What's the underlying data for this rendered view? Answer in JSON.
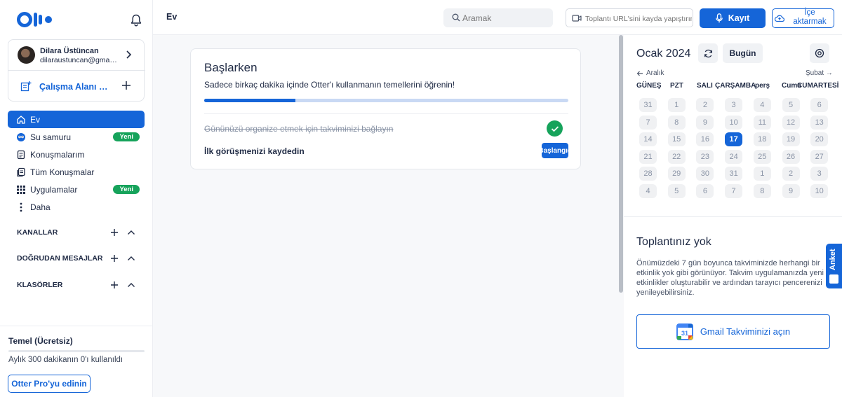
{
  "sidebar": {
    "account": {
      "name": "Dilara Üstüncan",
      "email": "dilaraustuncan@gmail.com"
    },
    "workspace_label": "Çalışma Alanı Oluştur",
    "nav": [
      {
        "label": "Ev",
        "icon": "home-icon",
        "active": true
      },
      {
        "label": "Su samuru",
        "icon": "otter-icon",
        "badge": "Yeni"
      },
      {
        "label": "Konuşmalarım",
        "icon": "document-icon"
      },
      {
        "label": "Tüm Konuşmalar",
        "icon": "documents-icon"
      },
      {
        "label": "Uygulamalar",
        "icon": "apps-grid-icon",
        "badge": "Yeni"
      },
      {
        "label": "Daha",
        "icon": "more-vertical-icon"
      }
    ],
    "sections": [
      "KANALLAR",
      "DOĞRUDAN MESAJLAR",
      "KLASÖRLER"
    ],
    "plan": {
      "title": "Temel (Ücretsiz)",
      "usage": "Aylık 300 dakikanın 0'ı kullanıldı",
      "usage_fraction": 0,
      "pro_button": "Otter Pro'yu edinin"
    }
  },
  "topbar": {
    "page_title": "Ev",
    "search_placeholder": "Aramak",
    "url_placeholder": "Toplantı URL'sini kayda yapıştırın",
    "record_button": "Kayıt",
    "import_button": "İçe aktarmak"
  },
  "getting_started": {
    "title": "Başlarken",
    "subtitle": "Sadece birkaç dakika içinde Otter'ı kullanmanın temellerini öğrenin!",
    "progress_fraction": 0.25,
    "tasks": [
      {
        "label": "Gününüzü organize etmek için takviminizi bağlayın",
        "done": true
      },
      {
        "label": "İlk görüşmenizi kaydedin",
        "done": false,
        "button": "Başlangıç"
      }
    ]
  },
  "calendar": {
    "title": "Ocak 2024",
    "today_button": "Bugün",
    "prev_month": "Aralık",
    "next_month": "Şubat",
    "weekdays": [
      "GÜNEŞ",
      "PZT",
      "SALI",
      "ÇARŞAMBA",
      "perş",
      "Cuma",
      "CUMARTESİ"
    ],
    "weeks": [
      [
        "31",
        "1",
        "2",
        "3",
        "4",
        "5",
        "6"
      ],
      [
        "7",
        "8",
        "9",
        "10",
        "11",
        "12",
        "13"
      ],
      [
        "14",
        "15",
        "16",
        "17",
        "18",
        "19",
        "20"
      ],
      [
        "21",
        "22",
        "23",
        "24",
        "25",
        "26",
        "27"
      ],
      [
        "28",
        "29",
        "30",
        "31",
        "1",
        "2",
        "3"
      ],
      [
        "4",
        "5",
        "6",
        "7",
        "8",
        "9",
        "10"
      ]
    ],
    "today": "17"
  },
  "meetings": {
    "title": "Toplantınız yok",
    "text": "Önümüzdeki 7 gün boyunca takviminizde herhangi bir etkinlik yok gibi görünüyor. Takvim uygulamanızda yeni etkinlikler oluşturabilir ve ardından tarayıcı pencerenizi yenileyebilirsiniz.",
    "gmail_button": "Gmail Takviminizi açın",
    "gcal_icon_number": "31"
  },
  "survey_tab": "Anket",
  "colors": {
    "accent": "#1565d8",
    "success": "#16a35b"
  }
}
